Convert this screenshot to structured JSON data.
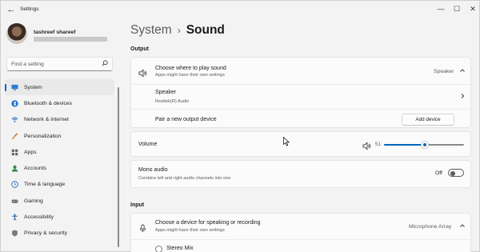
{
  "window": {
    "title": "Settings"
  },
  "profile": {
    "name": "tashreef shareef"
  },
  "search": {
    "placeholder": "Find a setting"
  },
  "sidebar": {
    "items": [
      {
        "label": "System",
        "icon": "monitor-icon",
        "active": true
      },
      {
        "label": "Bluetooth & devices",
        "icon": "bluetooth-icon"
      },
      {
        "label": "Network & internet",
        "icon": "wifi-icon"
      },
      {
        "label": "Personalization",
        "icon": "brush-icon"
      },
      {
        "label": "Apps",
        "icon": "apps-icon"
      },
      {
        "label": "Accounts",
        "icon": "person-icon"
      },
      {
        "label": "Time & language",
        "icon": "globe-clock-icon"
      },
      {
        "label": "Gaming",
        "icon": "gamepad-icon"
      },
      {
        "label": "Accessibility",
        "icon": "accessibility-icon"
      },
      {
        "label": "Privacy & security",
        "icon": "shield-icon"
      }
    ]
  },
  "breadcrumb": {
    "parent": "System",
    "separator": "›",
    "current": "Sound"
  },
  "output": {
    "section_label": "Output",
    "choose_title": "Choose where to play sound",
    "choose_sub": "Apps might have their own settings",
    "choose_value": "Speaker",
    "device_title": "Speaker",
    "device_sub": "Realtek(R) Audio",
    "pair_label": "Pair a new output device",
    "add_device_label": "Add device",
    "volume_label": "Volume",
    "volume_value": "51",
    "volume_level": 51,
    "mono_title": "Mono audio",
    "mono_sub": "Combine left and right audio channels into one",
    "mono_state": "Off"
  },
  "input": {
    "section_label": "Input",
    "choose_title": "Choose a device for speaking or recording",
    "choose_sub": "Apps might have their own settings",
    "choose_value": "Microphone Array",
    "device_1": "Stereo Mix"
  },
  "colors": {
    "accent": "#0067c0",
    "background": "#f3f3f3",
    "card": "#fbfbfb"
  }
}
